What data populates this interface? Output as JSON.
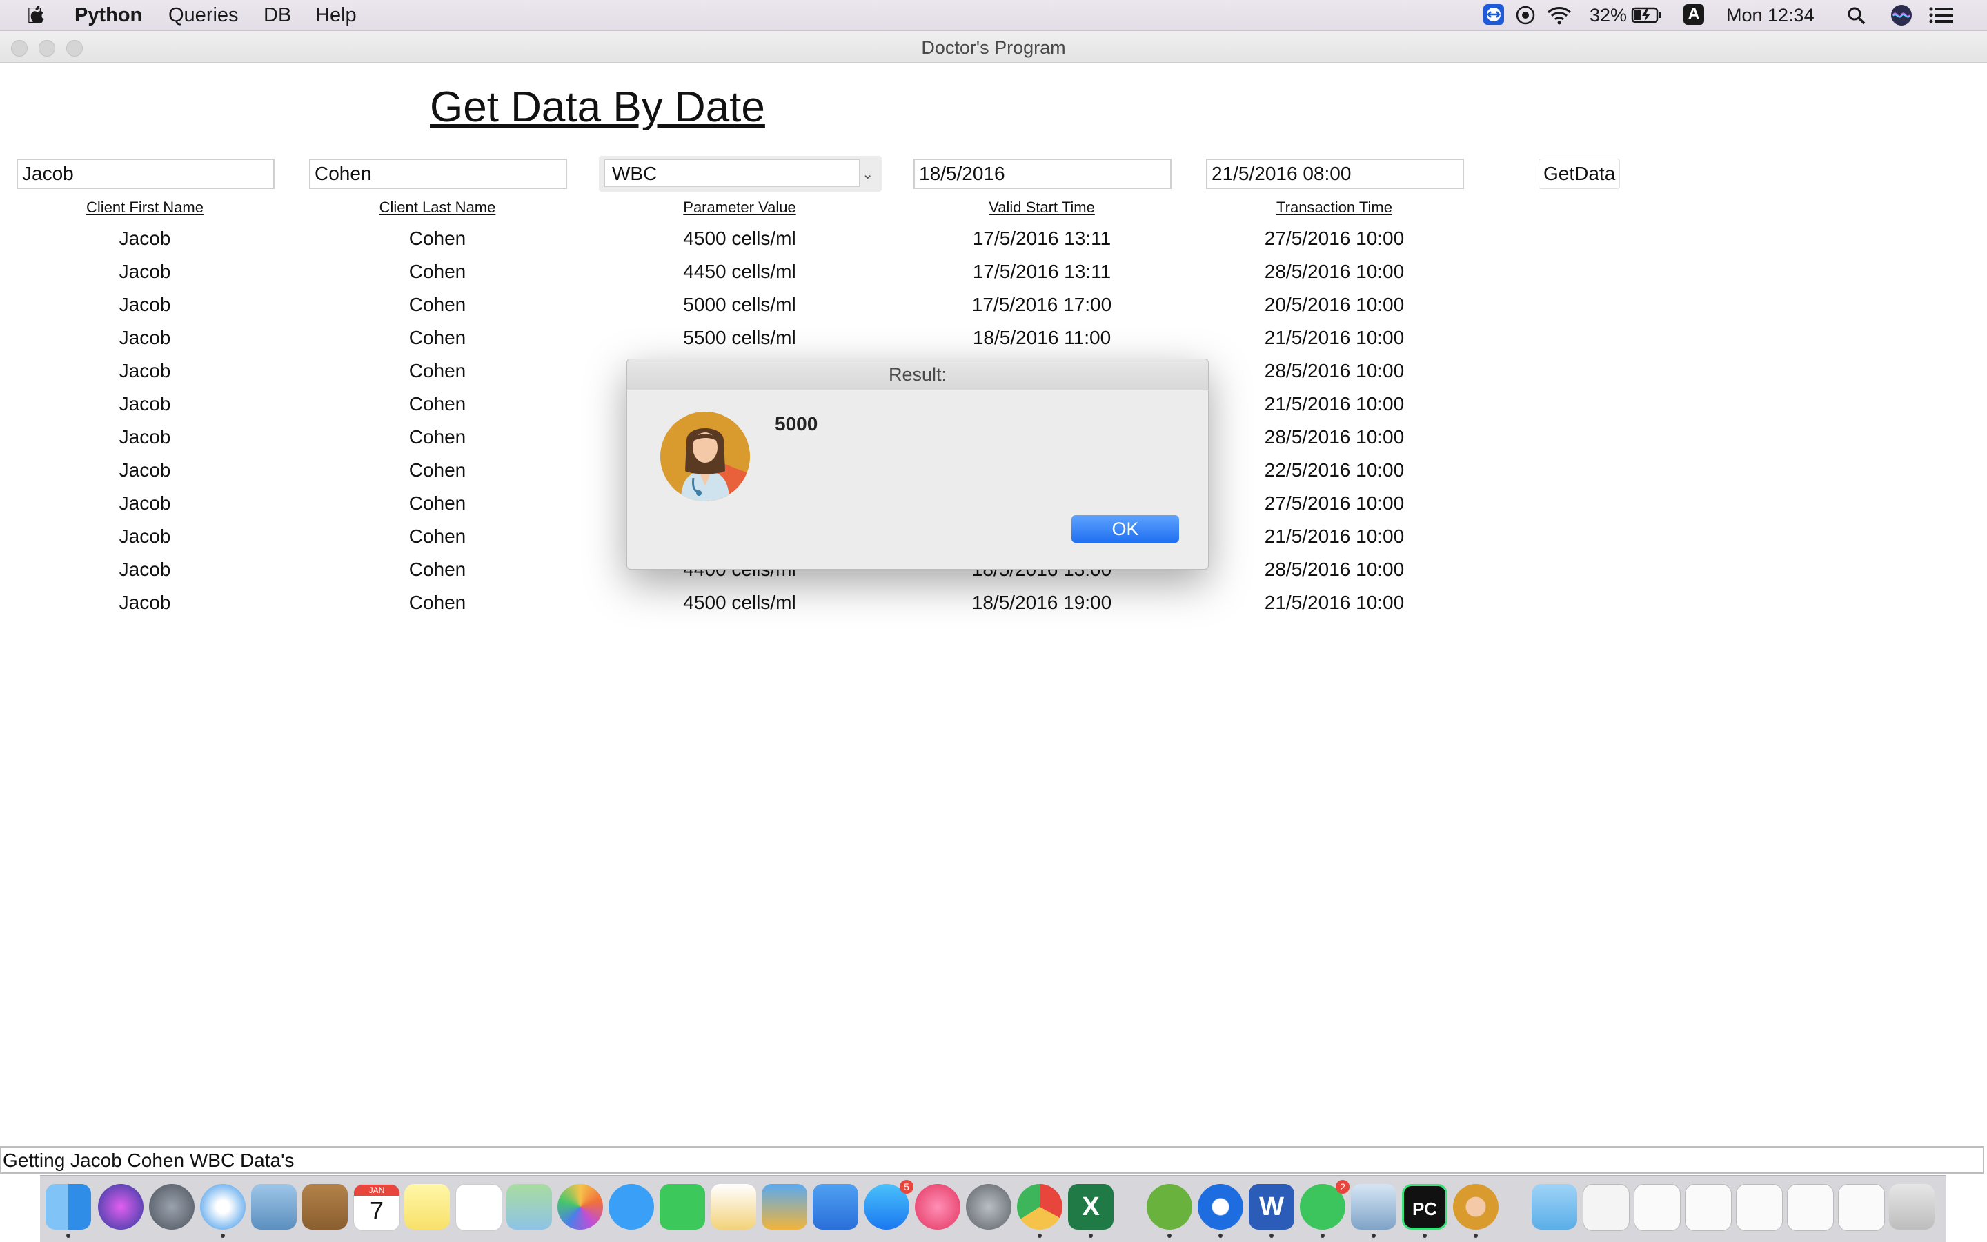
{
  "menubar": {
    "app_name": "Python",
    "items": [
      "Queries",
      "DB",
      "Help"
    ],
    "battery": "32%",
    "input_source": "A",
    "clock": "Mon 12:34"
  },
  "window": {
    "title": "Doctor's Program"
  },
  "heading": "Get Data By Date",
  "form": {
    "first_name": "Jacob",
    "last_name": "Cohen",
    "parameter": "WBC",
    "valid_date": "18/5/2016",
    "transaction_time": "21/5/2016 08:00",
    "get_button": "GetData"
  },
  "columns": [
    "Client First Name",
    "Client Last Name",
    "Parameter Value",
    "Valid Start Time",
    "Transaction Time"
  ],
  "rows": [
    [
      "Jacob",
      "Cohen",
      "4500 cells/ml",
      "17/5/2016 13:11",
      "27/5/2016 10:00"
    ],
    [
      "Jacob",
      "Cohen",
      "4450 cells/ml",
      "17/5/2016 13:11",
      "28/5/2016 10:00"
    ],
    [
      "Jacob",
      "Cohen",
      "5000 cells/ml",
      "17/5/2016 17:00",
      "20/5/2016 10:00"
    ],
    [
      "Jacob",
      "Cohen",
      "5500 cells/ml",
      "18/5/2016 11:00",
      "21/5/2016 10:00"
    ],
    [
      "Jacob",
      "Cohen",
      "",
      "",
      "28/5/2016 10:00"
    ],
    [
      "Jacob",
      "Cohen",
      "",
      "",
      "21/5/2016 10:00"
    ],
    [
      "Jacob",
      "Cohen",
      "",
      "",
      "28/5/2016 10:00"
    ],
    [
      "Jacob",
      "Cohen",
      "",
      "",
      "22/5/2016 10:00"
    ],
    [
      "Jacob",
      "Cohen",
      "",
      "",
      "27/5/2016 10:00"
    ],
    [
      "Jacob",
      "Cohen",
      "",
      "",
      "21/5/2016 10:00"
    ],
    [
      "Jacob",
      "Cohen",
      "4400 cells/ml",
      "18/5/2016 13:00",
      "28/5/2016 10:00"
    ],
    [
      "Jacob",
      "Cohen",
      "4500 cells/ml",
      "18/5/2016 19:00",
      "21/5/2016 10:00"
    ]
  ],
  "dialog": {
    "title": "Result:",
    "message": "5000",
    "ok_label": "OK",
    "icon": "doctor-avatar-icon"
  },
  "status": "Getting Jacob Cohen WBC Data's",
  "dock": {
    "calendar_month": "JAN",
    "calendar_day": "7",
    "appstore_badge": "5",
    "whatsapp_badge": "2",
    "excel_letter": "X",
    "word_letter": "W",
    "pycharm_letter": "PC"
  }
}
